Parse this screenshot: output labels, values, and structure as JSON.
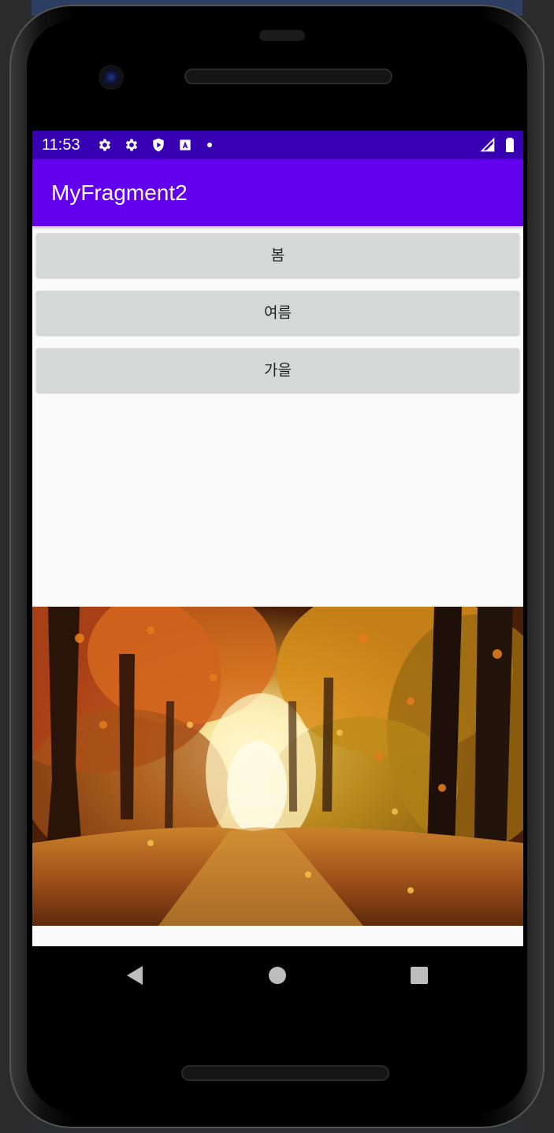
{
  "status_bar": {
    "time": "11:53",
    "icons": [
      "gear-icon",
      "gear-icon",
      "shield-play-icon",
      "a-box-icon",
      "dot-icon",
      "signal-icon",
      "battery-icon"
    ]
  },
  "app_bar": {
    "title": "MyFragment2",
    "color": "#6200ee",
    "status_color": "#3700b3"
  },
  "buttons": [
    {
      "label": "봄"
    },
    {
      "label": "여름"
    },
    {
      "label": "가을"
    }
  ],
  "fragment": {
    "image": "autumn-forest-path-image"
  },
  "nav_bar": {
    "icons": [
      "back-icon",
      "home-icon",
      "recents-icon"
    ]
  }
}
